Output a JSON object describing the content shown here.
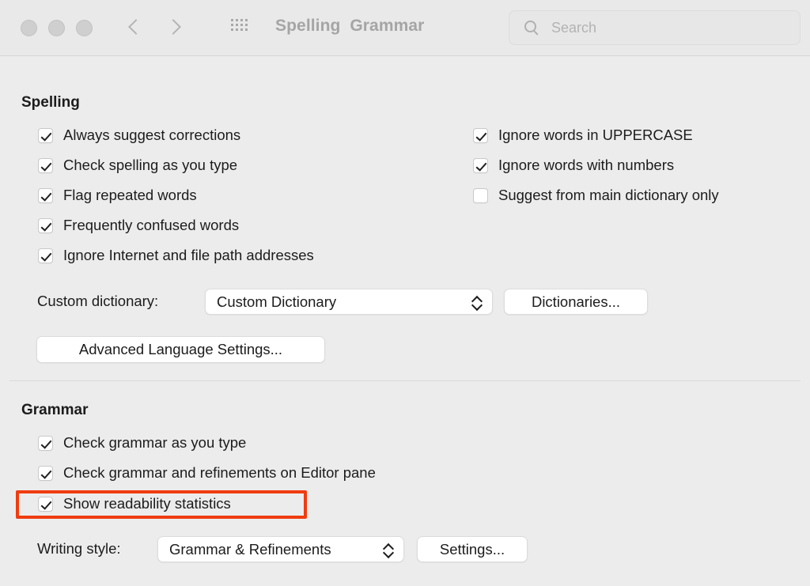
{
  "window": {
    "title": "Spelling  Grammar",
    "traffic_lights": [
      "close",
      "minimize",
      "zoom"
    ],
    "nav": {
      "back": "back-arrow",
      "forward": "forward-arrow"
    },
    "grid_icon": "grid-dots-icon",
    "search": {
      "placeholder": "Search",
      "value": "",
      "icon": "search-icon"
    }
  },
  "spelling": {
    "heading": "Spelling",
    "left_options": [
      {
        "label": "Always suggest corrections",
        "checked": true
      },
      {
        "label": "Check spelling as you type",
        "checked": true
      },
      {
        "label": "Flag repeated words",
        "checked": true
      },
      {
        "label": "Frequently confused words",
        "checked": true
      },
      {
        "label": "Ignore Internet and file path addresses",
        "checked": true
      }
    ],
    "right_options": [
      {
        "label": "Ignore words in UPPERCASE",
        "checked": true
      },
      {
        "label": "Ignore words with numbers",
        "checked": true
      },
      {
        "label": "Suggest from main dictionary only",
        "checked": false
      }
    ],
    "custom_dictionary": {
      "label": "Custom dictionary:",
      "selected": "Custom Dictionary",
      "options": [
        "Custom Dictionary"
      ]
    },
    "dictionaries_button": "Dictionaries...",
    "advanced_button": "Advanced Language Settings..."
  },
  "grammar": {
    "heading": "Grammar",
    "options": [
      {
        "label": "Check grammar as you type",
        "checked": true
      },
      {
        "label": "Check grammar and refinements on Editor pane",
        "checked": true
      },
      {
        "label": "Show readability statistics",
        "checked": true,
        "highlighted": true
      }
    ],
    "writing_style": {
      "label": "Writing style:",
      "selected": "Grammar & Refinements",
      "options": [
        "Grammar & Refinements"
      ]
    },
    "settings_button": "Settings..."
  },
  "colors": {
    "highlight": "#f03c10",
    "toolbar_bg": "#e9e9e9",
    "content_bg": "#ececec",
    "text": "#1c1c1c",
    "title_text": "#a5a5a5"
  }
}
